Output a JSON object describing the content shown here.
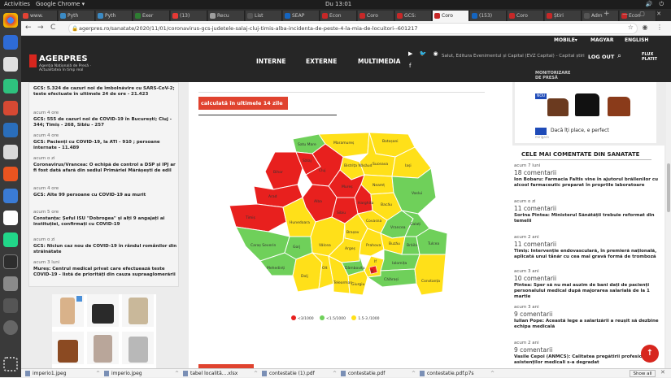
{
  "system": {
    "activities": "Activities",
    "app": "Google Chrome ▾",
    "clock": "Du 13:01",
    "tray": "🔊 ⏻"
  },
  "tabs": [
    {
      "label": "www.",
      "color": "#e34234"
    },
    {
      "label": "Pyth",
      "color": "#3b8ac4"
    },
    {
      "label": "Pyth",
      "color": "#3b8ac4"
    },
    {
      "label": "Exer",
      "color": "#2e7d32"
    },
    {
      "label": "(13) ",
      "color": "#e53935"
    },
    {
      "label": "Recu",
      "color": "#9e9e9e"
    },
    {
      "label": "List ",
      "color": "#555555"
    },
    {
      "label": "SEAP",
      "color": "#1565c0"
    },
    {
      "label": "Econ",
      "color": "#c62828"
    },
    {
      "label": "Coro",
      "color": "#c62828"
    },
    {
      "label": "GCS:",
      "color": "#c62828"
    },
    {
      "label": "Coro",
      "color": "#c62828",
      "active": true
    },
    {
      "label": "(153) ",
      "color": "#1565c0"
    },
    {
      "label": "Coro",
      "color": "#c62828"
    },
    {
      "label": "Știri",
      "color": "#c62828"
    },
    {
      "label": "Adm",
      "color": "#555555"
    },
    {
      "label": "Econ",
      "color": "#c62828"
    }
  ],
  "browser": {
    "user": "ra",
    "back": "←",
    "forward": "→",
    "reload": "C",
    "url": "agerpres.ro/sanatate/2020/11/01/coronavirus-gcs-judetele-salaj-cluj-timis-alba-incidenta-de-peste-4-la-mia-de-locuitori--601217"
  },
  "header": {
    "brand": "AGERPRES",
    "tagline": "Agenția Națională de Presă · Actualitatea în timp real",
    "mobile": "MOBILE▾",
    "magyar": "MAGYAR",
    "english": "ENGLISH",
    "nav": [
      "INTERNE",
      "EXTERNE",
      "MULTIMEDIA"
    ],
    "ticker": "Salut, Editura Evenimentul și Capital (EVZ Capital) - Capital știri",
    "logout": "LOG OUT",
    "flux": "FLUX\nPLATIT",
    "monitor": "MONITORIZARE\nDE PRESĂ"
  },
  "left_news": [
    {
      "time": "",
      "text": "GCS: 5.324 de cazuri noi de îmbolnăvire cu SARS-CoV-2; teste efectuate în ultimele 24 de ore - 21.423"
    },
    {
      "time": "acum 4 ore",
      "text": "GCS: 555 de cazuri noi de COVID-19 în București; Cluj - 344; Timiș - 268, Sibiu - 257"
    },
    {
      "time": "acum 4 ore",
      "text": "GCS: Pacienți cu COVID-19, la ATI - 910 ; persoane internate - 11.489"
    },
    {
      "time": "acum o zi",
      "text": "Coronavirus/Vrancea: O echipă de control a DSP și IPJ ar fi fost dată afară din sediul Primăriei Mărășești de edil"
    },
    {
      "time": "acum 4 ore",
      "text": "GCS: Alte 99 persoane cu COVID-19 au murit"
    },
    {
      "time": "acum 5 ore",
      "text": "Constanța: Șeful ISU \"Dobrogea\" și alți 9 angajați ai instituției, confirmați cu COVID-19"
    },
    {
      "time": "acum o zi",
      "text": "GCS: Niciun caz nou de COVID-19 în rândul românilor din străinătate"
    },
    {
      "time": "acum 3 luni",
      "text": "Mureș: Centrul medical privat care efectuează teste COVID-19 - listă de priorități din cauza supraaglomerării"
    }
  ],
  "main": {
    "heading": "calculată în ultimele 14 zile",
    "legend": [
      "<3/1000",
      "<1.5/1000",
      "1.5-3 /1000"
    ]
  },
  "map_labels": {
    "satu_mare": "Satu Mare",
    "maramures": "Maramureș",
    "botosani": "Botoșani",
    "suceava": "Suceava",
    "salaj": "Sălaj",
    "bihor": "Bihor",
    "bistrita": "Bistrița Năsăud",
    "iasi": "Iași",
    "neamt": "Neamț",
    "cluj": "Cluj",
    "mures": "Mureș",
    "arad": "Arad",
    "alba": "Alba",
    "harghita": "Harghita",
    "bacau": "Bacău",
    "vaslui": "Vaslui",
    "timis": "Timiș",
    "hunedoara": "Hunedoara",
    "sibiu": "Sibiu",
    "covasna": "Covasna",
    "vrancea": "Vrancea",
    "galati": "Galați",
    "brasov": "Brașov",
    "caras": "Caraș Severin",
    "gorj": "Gorj",
    "valcea": "Vâlcea",
    "arges": "Argeș",
    "prahova": "Prahova",
    "buzau": "Buzău",
    "braila": "Brăila",
    "tulcea": "Tulcea",
    "mehedinti": "Mehedinți",
    "dambovita": "Dâmbovița",
    "ialomita": "Ialomița",
    "dolj": "Dolj",
    "olt": "Olt",
    "teleorman": "Teleorman",
    "giurgiu": "Giurgiu",
    "calarasi": "Călărași",
    "constanta": "Constanța",
    "bucuresti": "B",
    "ilfov": "If"
  },
  "sponsored": {
    "badge": "NOU",
    "caption": "Dacă îți place, e perfect",
    "source": "mirigara"
  },
  "comments": {
    "title": "CELE MAI COMENTATE DIN SANATATE",
    "items": [
      {
        "time": "acum 7 luni",
        "count": "18 comentarii",
        "text": "Ion Bobaru: Farmacia Faltis vine în ajutorul brăilenilor cu alcool farmaceutic preparat în propriile laboratoare"
      },
      {
        "time": "acum o zi",
        "count": "11 comentarii",
        "text": "Sorina Pintea: Ministerul Sănătății trebuie reformat din temelii"
      },
      {
        "time": "acum 2 ani",
        "count": "11 comentarii",
        "text": "Timiș: Intervenție endovasculară, în premieră națională, aplicată unui tânăr cu cea mai gravă formă de tromboză"
      },
      {
        "time": "acum 3 ani",
        "count": "10 comentarii",
        "text": "Pintea: Sper să nu mai auzim de bani dați de pacienți personalului medical după majorarea salarială de la 1 martie"
      },
      {
        "time": "acum 3 ani",
        "count": "9 comentarii",
        "text": "Iulian Pope: Această lege a salarizării a reușit să dezbine echipa medicală"
      },
      {
        "time": "acum 2 ani",
        "count": "9 comentarii",
        "text": "Vasile Cepoi (ANMCS): Calitatea pregătirii profesionale a asistenților medicali s-a degradat"
      }
    ]
  },
  "downloads": {
    "items": [
      "imperio1.jpeg",
      "imperio.jpeg",
      "tabel localită....xlsx",
      "contestatie (1).pdf",
      "contestatie.pdf",
      "contestatie.pdf.p7s"
    ],
    "show_all": "Show all"
  },
  "colors": {
    "red": "#e8201e",
    "green": "#6fd05a",
    "yellow": "#ffe019",
    "brand": "#d7261e"
  }
}
